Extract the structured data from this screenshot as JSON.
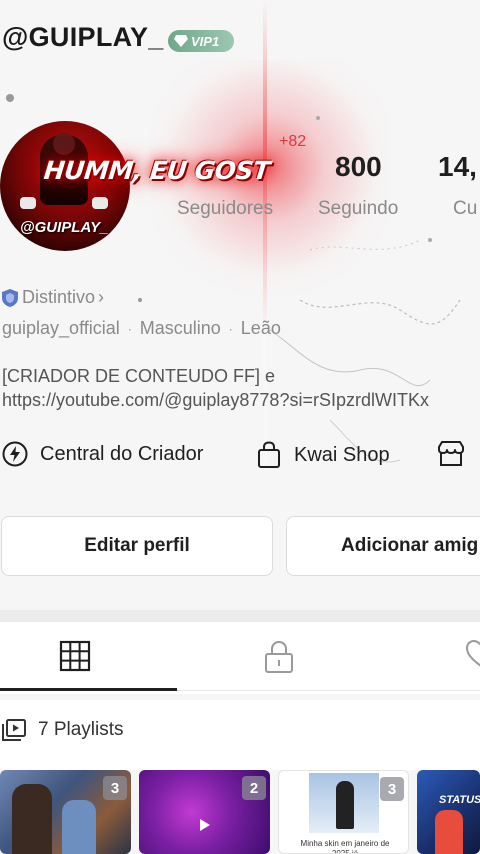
{
  "header": {
    "username": "@GUIPLAY_",
    "vip_label": "VIP1"
  },
  "avatar": {
    "tag": "@GUIPLAY_",
    "banner": "HUMM, EU GOST"
  },
  "notification": {
    "plus": "+82"
  },
  "stats": [
    {
      "value": "",
      "label": "Seguidores"
    },
    {
      "value": "800",
      "label": "Seguindo"
    },
    {
      "value": "14,",
      "label": "Cu"
    }
  ],
  "badge": {
    "label": "Distintivo",
    "chevron": "›",
    "icon": "shield-icon"
  },
  "meta": {
    "handle": "guiplay_official",
    "gender": "Masculino",
    "sign": "Leão",
    "separator": "·"
  },
  "bio": {
    "line1": "[CRIADOR DE CONTEUDO FF] e",
    "line2": "https://youtube.com/@guiplay8778?si=rSIpzrdlWITKx"
  },
  "links": [
    {
      "label": "Central do Criador",
      "icon": "lightning-icon"
    },
    {
      "label": "Kwai Shop",
      "icon": "shopping-bag-icon"
    },
    {
      "label": "",
      "icon": "store-icon"
    }
  ],
  "buttons": {
    "edit": "Editar perfil",
    "add": "Adicionar amig"
  },
  "tabs": [
    {
      "icon": "grid-icon",
      "active": true
    },
    {
      "icon": "lock-icon",
      "active": false
    },
    {
      "icon": "heart-icon",
      "active": false
    }
  ],
  "playlists": {
    "label": "7 Playlists",
    "icon": "playlist-icon"
  },
  "thumbnails": [
    {
      "count": "3",
      "caption": ""
    },
    {
      "count": "2",
      "caption": ""
    },
    {
      "count": "3",
      "caption": "Minha skin em janeiro de 2025 já"
    },
    {
      "count": "",
      "caption": "STATUS"
    }
  ],
  "colors": {
    "accent_red": "#e01820",
    "vip_green": "#7fb69a",
    "text_dark": "#1f1f1f",
    "text_gray": "#8a8a8a"
  }
}
